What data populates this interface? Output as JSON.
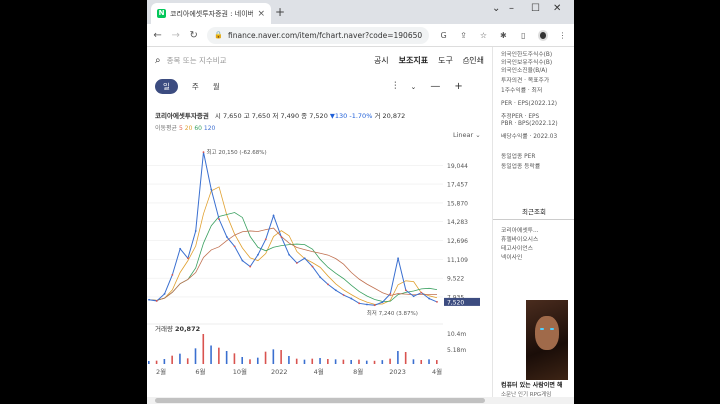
{
  "browser": {
    "tab_title": "코리아에셋투자증권 : 네이버 증",
    "tab_close": "×",
    "new_tab": "+",
    "minimize": "⌄",
    "url": "finance.naver.com/item/fchart.naver?code=190650"
  },
  "toolbar": {
    "search_placeholder": "종목 또는 지수비교",
    "disclosure": "공시",
    "indicators": "보조지표",
    "tools": "도구",
    "print": "인쇄"
  },
  "periods": {
    "day": "일",
    "week": "주",
    "month": "월"
  },
  "quote": {
    "name": "코리아에셋투자증권",
    "open_label": "시",
    "open": "7,650",
    "high_label": "고",
    "high": "7,650",
    "low_label": "저",
    "low": "7,490",
    "close_label": "종",
    "close": "7,520",
    "change": "▼130 -1.70%",
    "volume_label": "거",
    "volume": "20,872"
  },
  "ma": {
    "label": "이동평균",
    "ma5": "5",
    "ma20": "20",
    "ma60": "60",
    "ma120": "120"
  },
  "scale": "Linear",
  "sidebar": {
    "lines_top": [
      "외국인한도주식수(B)",
      "외국인보유주식수(B)",
      "외국인소진율(B/A)"
    ],
    "target_lines": [
      "투자의견 · 목표주가",
      "1주수익률 · 최저"
    ],
    "per_lines": [
      "PER · EPS(2022.12)",
      "추정PER · EPS",
      "PBR · BPS(2022.12)",
      "배당수익률 · 2022.03"
    ],
    "industry_lines": [
      "동일업종 PER",
      "동일업종 등락률"
    ],
    "recent_tab": "최근조회",
    "recent_items": [
      "코리아에셋투...",
      "휴젤바이오시스",
      "테고사이언스",
      "넥이사인"
    ],
    "ad_title": "컴퓨터 있는 사람이면 해",
    "ad_sub": "소문난 인기 RPG게임"
  },
  "chart_data": {
    "type": "line",
    "x": [
      "2월",
      "6월",
      "10월",
      "2022",
      "4월",
      "8월",
      "2023",
      "4월"
    ],
    "y_ticks": [
      19044,
      17457,
      15870,
      14283,
      12696,
      11109,
      9522,
      7935
    ],
    "ylim": [
      6500,
      20500
    ],
    "current_price": "7,520",
    "max_annotation": "최고 20,150 (-62.68%)",
    "min_annotation": "최저 7,240 (3.87%)",
    "series": [
      {
        "values": [
          7700,
          7600,
          8200,
          9800,
          12000,
          11200,
          13500,
          20150,
          17000,
          14500,
          13000,
          12200,
          11000,
          10500,
          11500,
          12800,
          14800,
          13000,
          11500,
          10800,
          11200,
          10500,
          9600,
          9000,
          8500,
          8100,
          7800,
          7400,
          7300,
          7240,
          7500,
          8200,
          11200,
          8500,
          8000,
          8300,
          7800,
          7520
        ]
      }
    ],
    "volume": {
      "label": "거래량",
      "value": "20,872",
      "y_ticks": [
        "10.4m",
        "5.18m"
      ]
    }
  }
}
